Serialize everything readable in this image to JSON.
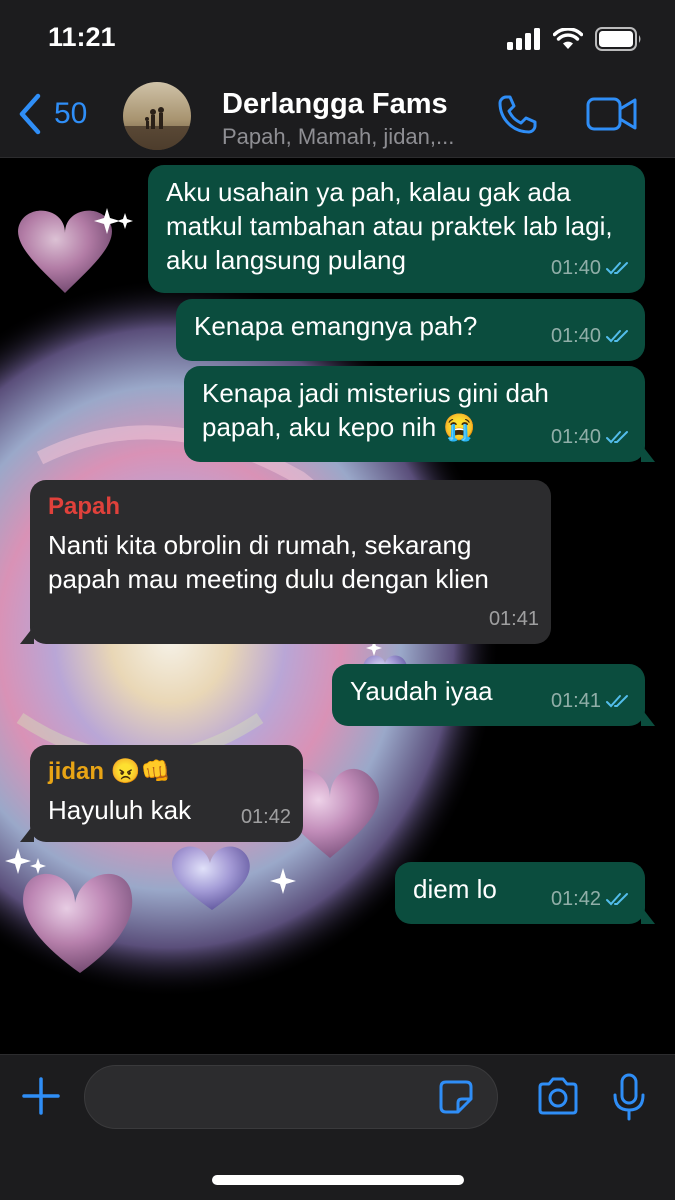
{
  "status": {
    "time": "11:21"
  },
  "header": {
    "back_count": "50",
    "title": "Derlangga Fams",
    "subtitle": "Papah, Mamah, jidan,..."
  },
  "messages": [
    {
      "direction": "out",
      "text": "Aku usahain ya pah, kalau gak ada matkul tambahan atau praktek lab lagi, aku langsung pulang",
      "time": "01:40",
      "status": "read"
    },
    {
      "direction": "out",
      "text": "Kenapa emangnya pah?",
      "time": "01:40",
      "status": "read"
    },
    {
      "direction": "out",
      "text": "Kenapa jadi misterius gini dah papah, aku kepo nih 😭",
      "time": "01:40",
      "status": "read"
    },
    {
      "direction": "in",
      "sender": "Papah",
      "sender_color": "#e0413b",
      "text": "Nanti kita obrolin di rumah, sekarang papah mau meeting dulu dengan klien",
      "time": "01:41"
    },
    {
      "direction": "out",
      "text": "Yaudah iyaa",
      "time": "01:41",
      "status": "read"
    },
    {
      "direction": "in",
      "sender": "jidan 😠👊",
      "sender_color": "#e8a415",
      "text": "Hayuluh kak",
      "time": "01:42"
    },
    {
      "direction": "out",
      "text": "diem lo",
      "time": "01:42",
      "status": "read"
    }
  ],
  "colors": {
    "accent": "#2f8ef7",
    "outgoing_bubble": "#0b4d3e",
    "incoming_bubble": "#2c2c2e",
    "read_ticks": "#53bdeb"
  },
  "icons": {
    "back": "chevron-left-icon",
    "call": "phone-icon",
    "video": "video-camera-icon",
    "plus": "plus-icon",
    "sticker": "sticker-icon",
    "camera": "camera-icon",
    "mic": "microphone-icon"
  }
}
